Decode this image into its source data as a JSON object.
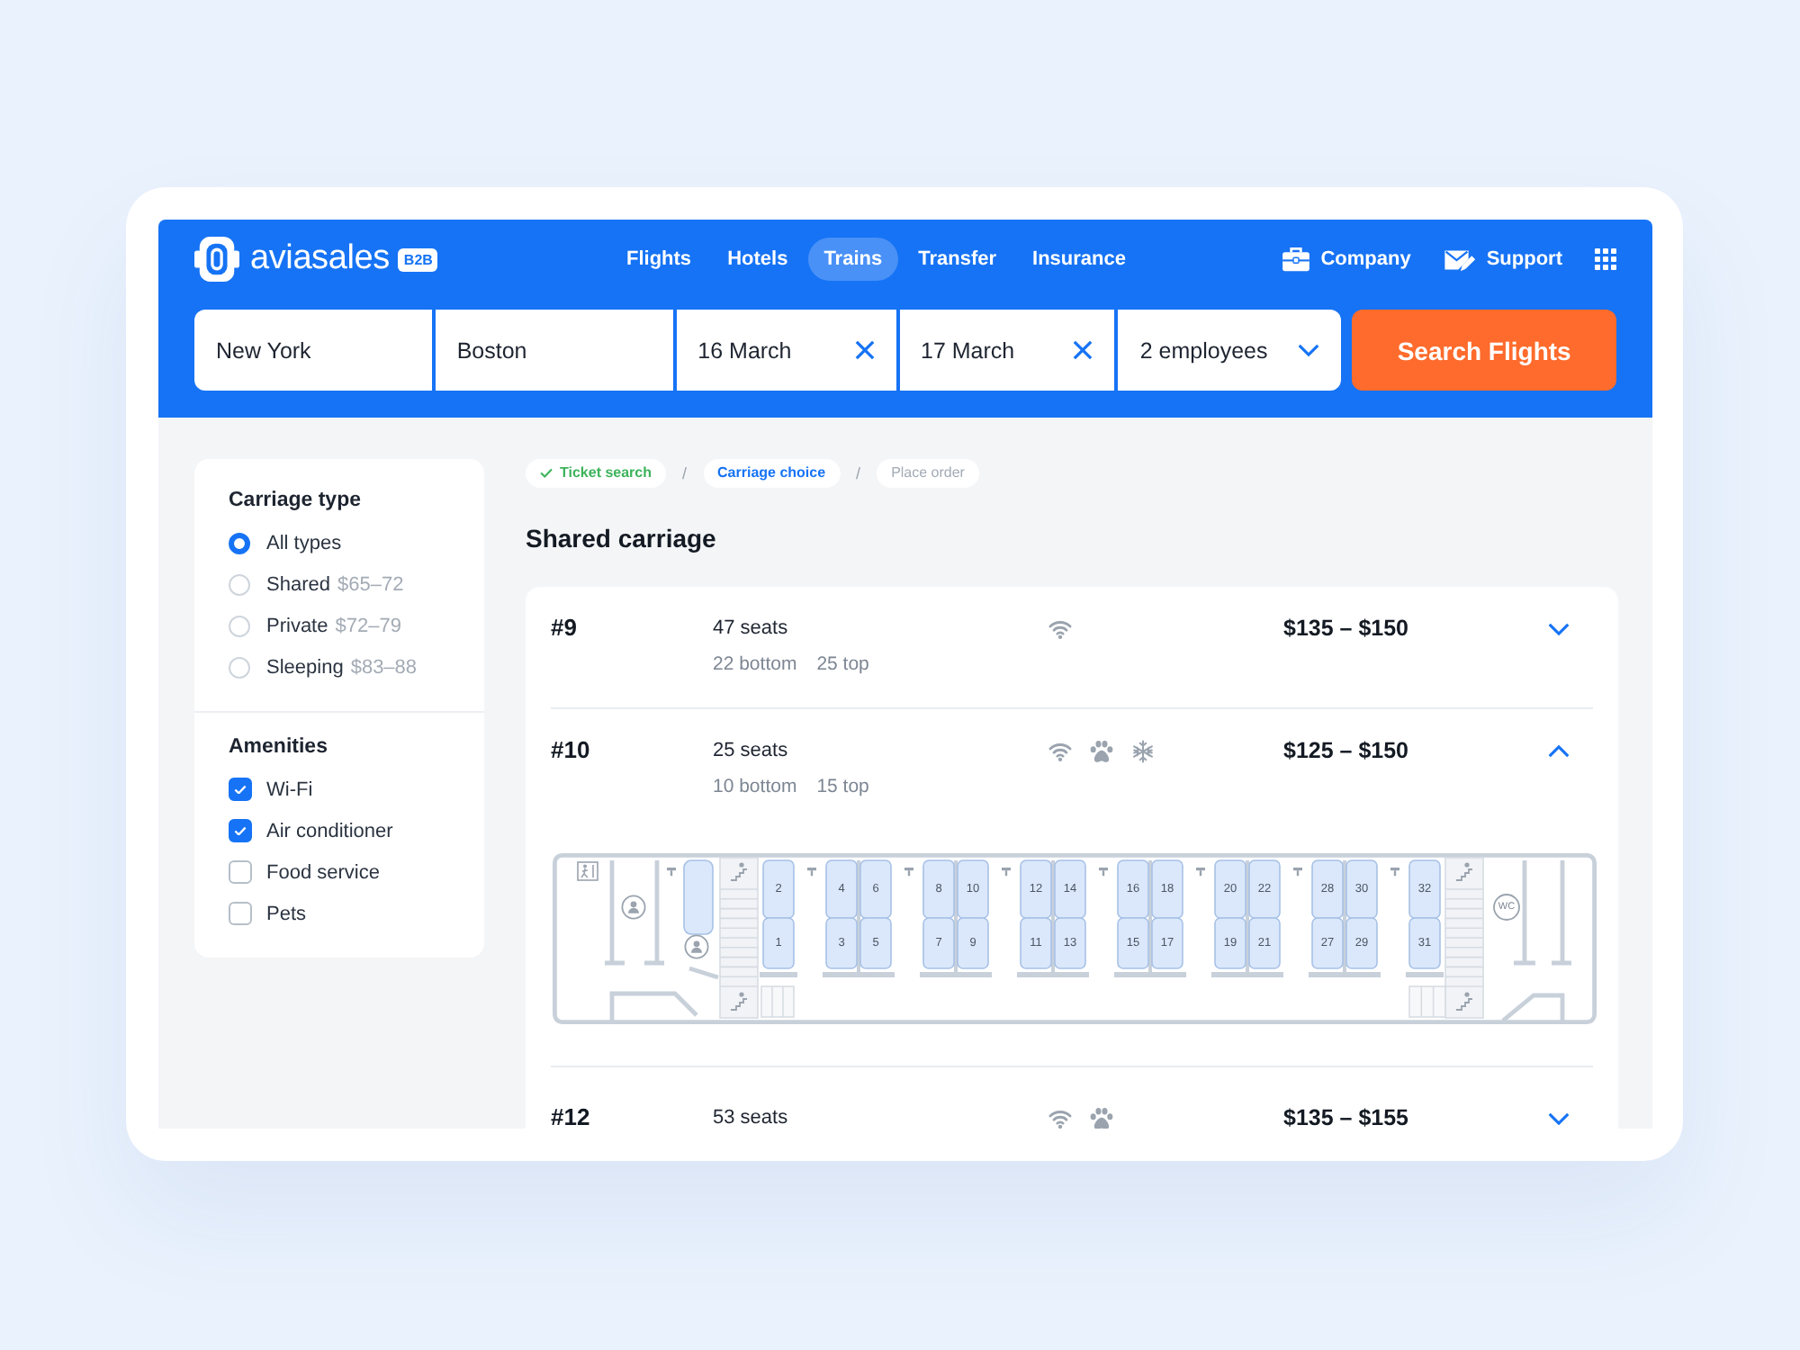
{
  "header": {
    "logo": {
      "wordmark": "aviasales",
      "badge": "B2B"
    },
    "nav": [
      {
        "label": "Flights",
        "selected": false
      },
      {
        "label": "Hotels",
        "selected": false
      },
      {
        "label": "Trains",
        "selected": true
      },
      {
        "label": "Transfer",
        "selected": false
      },
      {
        "label": "Insurance",
        "selected": false
      }
    ],
    "links": [
      {
        "kind": "company",
        "label": "Company"
      },
      {
        "kind": "support",
        "label": "Support"
      }
    ],
    "search": {
      "fields": [
        {
          "kind": "text",
          "value": "New York"
        },
        {
          "kind": "text",
          "value": "Boston"
        },
        {
          "kind": "clearable",
          "value": "16 March"
        },
        {
          "kind": "clearable",
          "value": "17 March"
        },
        {
          "kind": "select",
          "value": "2 employees"
        }
      ],
      "button": "Search Flights"
    }
  },
  "filters": {
    "carriage_type": {
      "title": "Carriage type",
      "options": [
        {
          "label": "All types",
          "selected": true
        },
        {
          "label": "Shared",
          "price": "$65–72",
          "selected": false
        },
        {
          "label": "Private",
          "price": "$72–79",
          "selected": false
        },
        {
          "label": "Sleeping",
          "price": "$83–88",
          "selected": false
        }
      ]
    },
    "amenities": {
      "title": "Amenities",
      "options": [
        {
          "label": "Wi-Fi",
          "checked": true
        },
        {
          "label": "Air conditioner",
          "checked": true
        },
        {
          "label": "Food service",
          "checked": false
        },
        {
          "label": "Pets",
          "checked": false
        }
      ]
    }
  },
  "breadcrumbs": {
    "steps": [
      {
        "label": "Ticket search",
        "done": true,
        "selected": false
      },
      {
        "label": "Carriage choice",
        "done": false,
        "selected": true
      },
      {
        "label": "Place order",
        "done": false,
        "selected": false
      }
    ],
    "separators": [
      "/",
      "/"
    ]
  },
  "carriage_list": {
    "title": "Shared carriage",
    "carriages": [
      {
        "number": "#9",
        "seats": "47 seats",
        "bottom": "22 bottom",
        "top": "25 top",
        "amenities": [
          {
            "kind": "wifi"
          }
        ],
        "price": "$135 – $150",
        "expanded": false
      },
      {
        "number": "#10",
        "seats": "25 seats",
        "bottom": "10 bottom",
        "top": "15 top",
        "amenities": [
          {
            "kind": "wifi"
          },
          {
            "kind": "pets"
          },
          {
            "kind": "air-conditioning"
          }
        ],
        "price": "$125 – $150",
        "expanded": true,
        "map": {
          "seat_columns": [
            {
              "upper": "2",
              "lower": "1"
            },
            {
              "upper": "4",
              "lower": "3"
            },
            {
              "upper": "6",
              "lower": "5"
            },
            {
              "upper": "8",
              "lower": "7"
            },
            {
              "upper": "10",
              "lower": "9"
            },
            {
              "upper": "12",
              "lower": "11"
            },
            {
              "upper": "14",
              "lower": "13"
            },
            {
              "upper": "16",
              "lower": "15"
            },
            {
              "upper": "18",
              "lower": "17"
            },
            {
              "upper": "20",
              "lower": "19"
            },
            {
              "upper": "22",
              "lower": "21"
            },
            {
              "upper": "28",
              "lower": "27"
            },
            {
              "upper": "30",
              "lower": "29"
            },
            {
              "upper": "32",
              "lower": "31"
            }
          ],
          "wc_label": "WC"
        }
      },
      {
        "number": "#12",
        "seats": "53 seats",
        "amenities": [
          {
            "kind": "wifi"
          },
          {
            "kind": "pets"
          }
        ],
        "price": "$135 – $155",
        "expanded": false
      }
    ]
  }
}
